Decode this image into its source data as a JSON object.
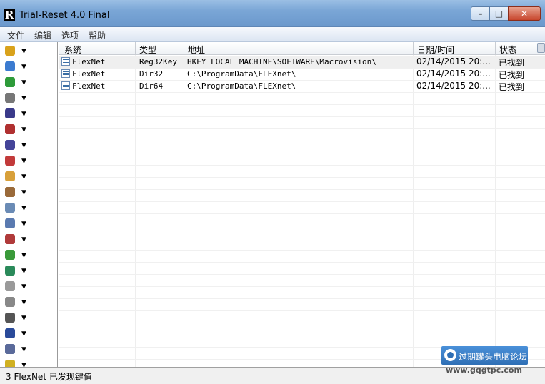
{
  "window": {
    "title": "Trial-Reset 4.0 Final",
    "app_icon_letter": "R",
    "minimize": "–",
    "maximize": "□",
    "close": "✕"
  },
  "menu": [
    "文件",
    "编辑",
    "选项",
    "帮助"
  ],
  "toolbar_icons": [
    {
      "name": "cube-icon",
      "color": "#d9a21b"
    },
    {
      "name": "globe-icon",
      "color": "#3b7bd0"
    },
    {
      "name": "plug-icon",
      "color": "#2e9b3a"
    },
    {
      "name": "box-icon",
      "color": "#777777"
    },
    {
      "name": "shield-icon",
      "color": "#3a3a8a"
    },
    {
      "name": "ccg-icon",
      "color": "#b03030"
    },
    {
      "name": "target-icon",
      "color": "#444499"
    },
    {
      "name": "puzzle-icon",
      "color": "#c23a3a"
    },
    {
      "name": "key-icon",
      "color": "#d8a03a"
    },
    {
      "name": "flame-icon",
      "color": "#9a6a3a"
    },
    {
      "name": "flexnet-icon",
      "color": "#6a8bb5"
    },
    {
      "name": "document-icon",
      "color": "#5a7ab0"
    },
    {
      "name": "molecule-icon",
      "color": "#b03a3a"
    },
    {
      "name": "apple-icon",
      "color": "#3a9a3a"
    },
    {
      "name": "m-circle-icon",
      "color": "#2a8a5a"
    },
    {
      "name": "tools-icon",
      "color": "#9a9a9a"
    },
    {
      "name": "gear-icon",
      "color": "#888888"
    },
    {
      "name": "lock-icon",
      "color": "#555555"
    },
    {
      "name": "badge-icon",
      "color": "#2a4a9a"
    },
    {
      "name": "bottle-icon",
      "color": "#5a6a9a"
    },
    {
      "name": "warning-icon",
      "color": "#d0b020"
    }
  ],
  "columns": [
    "系统",
    "类型",
    "地址",
    "日期/时间",
    "状态"
  ],
  "rows": [
    {
      "system": "FlexNet",
      "type": "Reg32Key",
      "address": "HKEY_LOCAL_MACHINE\\SOFTWARE\\Macrovision\\",
      "datetime": "02/14/2015 20:...",
      "status": "已找到"
    },
    {
      "system": "FlexNet",
      "type": "Dir32",
      "address": "C:\\ProgramData\\FLEXnet\\",
      "datetime": "02/14/2015 20:...",
      "status": "已找到"
    },
    {
      "system": "FlexNet",
      "type": "Dir64",
      "address": "C:\\ProgramData\\FLEXnet\\",
      "datetime": "02/14/2015 20:...",
      "status": "已找到"
    }
  ],
  "status_bar": "3 FlexNet 已发现键值",
  "watermark": {
    "text": "过期罐头电脑论坛",
    "url": "www.gqgtpc.com"
  }
}
